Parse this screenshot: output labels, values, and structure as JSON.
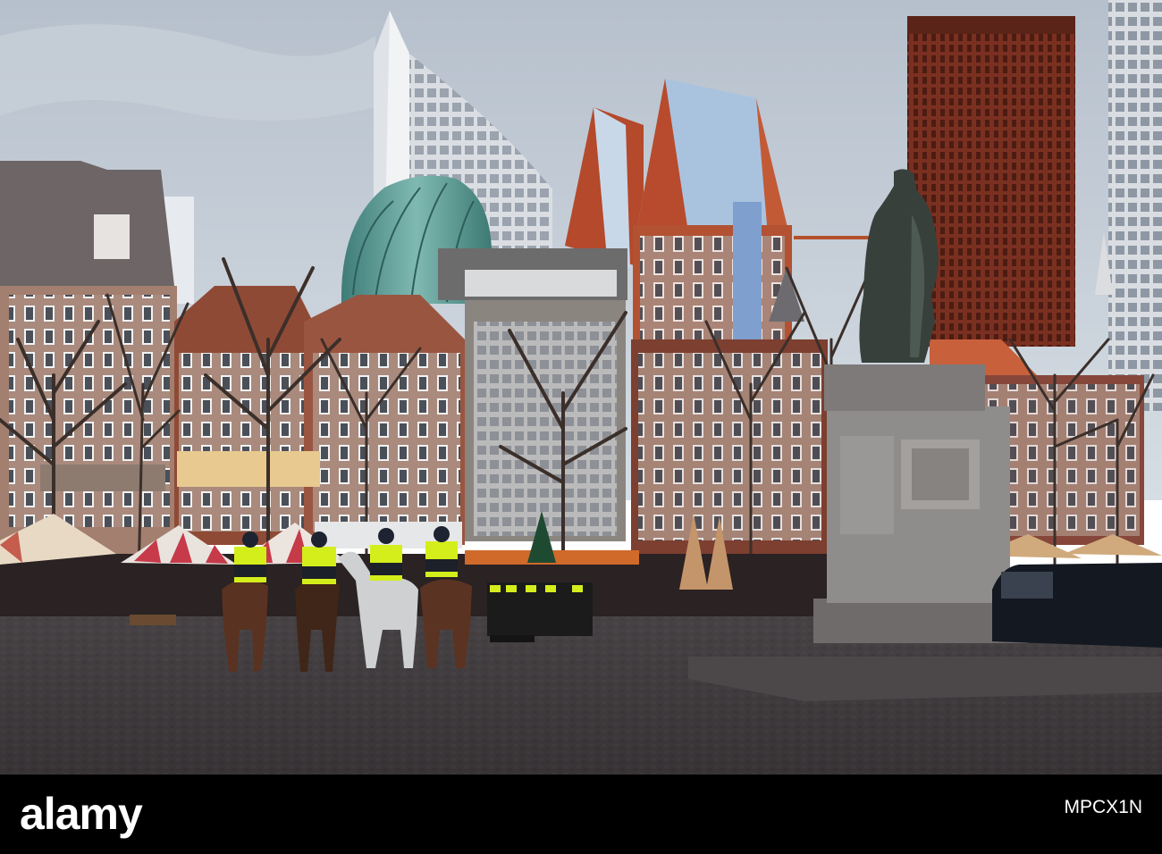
{
  "banner": {
    "brand": "alamy",
    "stock_id": "MPCX1N",
    "background": "#000000",
    "text_color": "#ffffff"
  },
  "scene": {
    "sky_color": "#c6cfd9",
    "ground_color": "#3f3a3d",
    "police_vest_color": "#d4ee1c",
    "tower_brick_color": "#6d2a1a",
    "glass_dome_color": "#4c8c86"
  }
}
